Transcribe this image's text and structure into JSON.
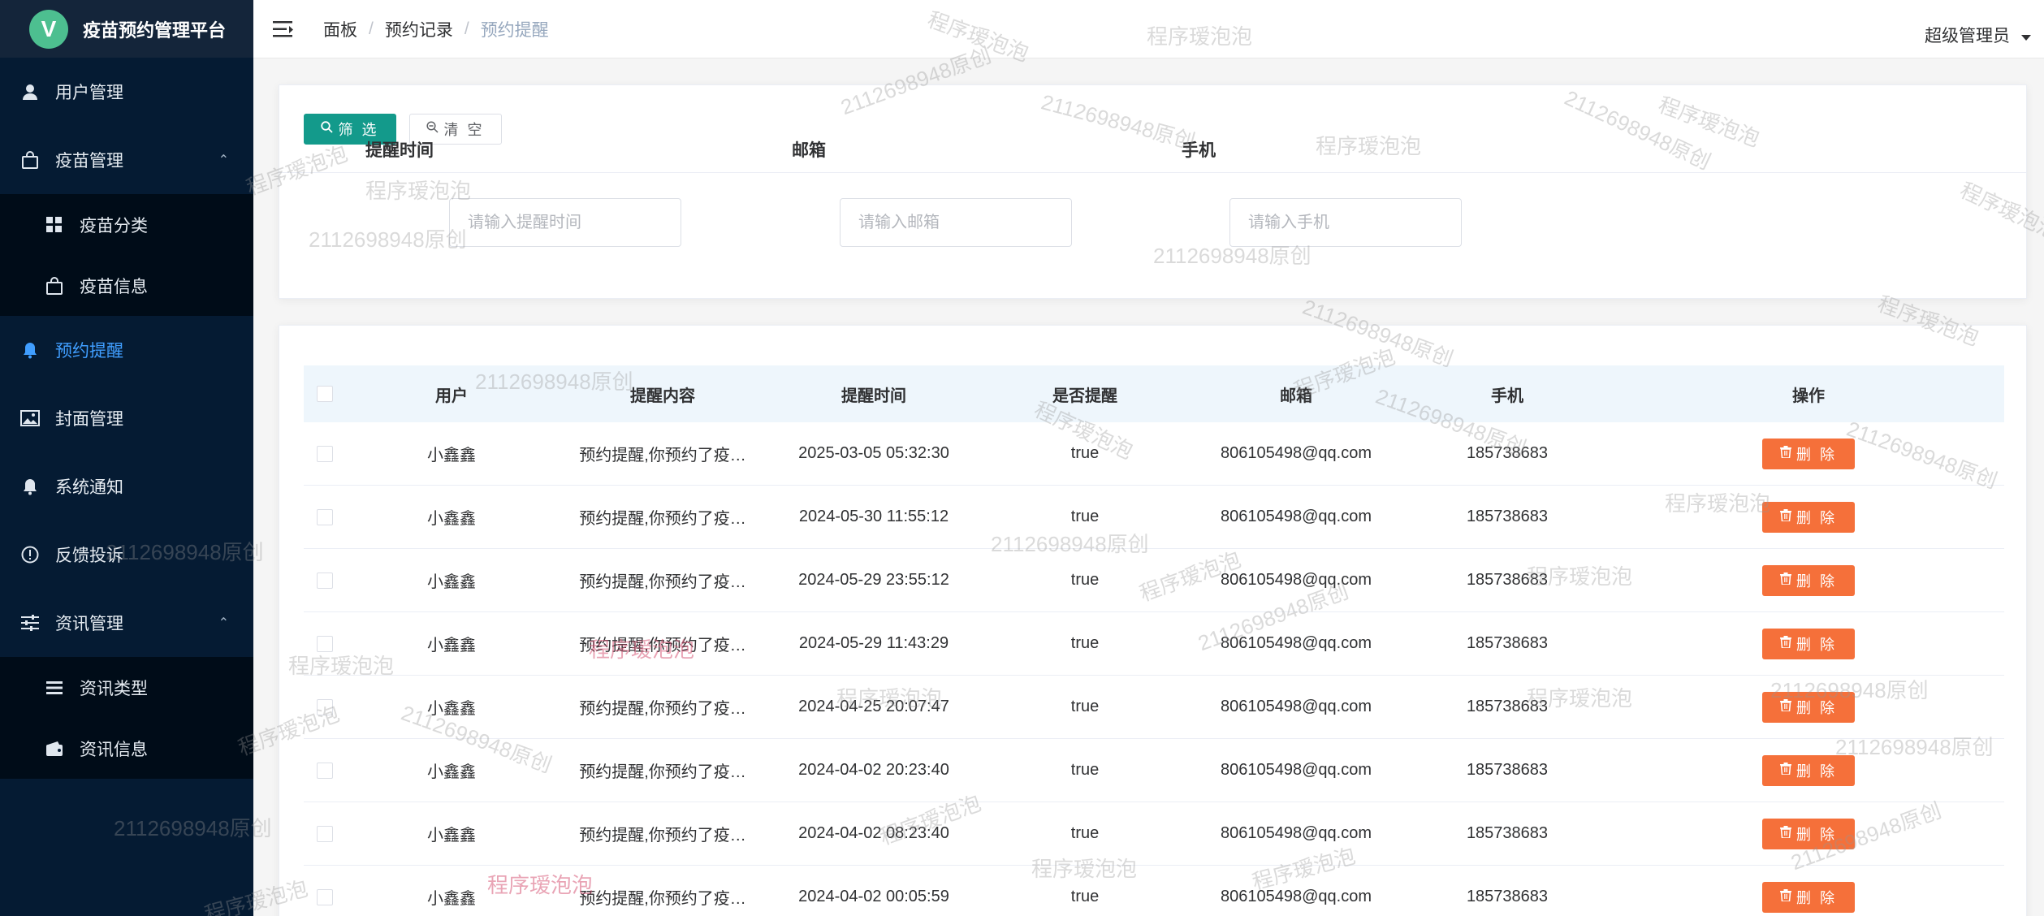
{
  "app": {
    "logo_letter": "V",
    "title": "疫苗预约管理平台"
  },
  "sidebar": {
    "items": [
      {
        "label": "用户管理",
        "icon": "user-icon",
        "caret": ""
      },
      {
        "label": "疫苗管理",
        "icon": "bag-icon",
        "caret": "⌃"
      },
      {
        "label": "疫苗分类",
        "icon": "grid-icon",
        "sub": true
      },
      {
        "label": "疫苗信息",
        "icon": "bag-icon",
        "sub": true
      },
      {
        "label": "预约提醒",
        "icon": "bell-icon",
        "active": true
      },
      {
        "label": "封面管理",
        "icon": "picture-icon"
      },
      {
        "label": "系统通知",
        "icon": "bell-icon"
      },
      {
        "label": "反馈投诉",
        "icon": "warning-icon"
      },
      {
        "label": "资讯管理",
        "icon": "sliders-icon",
        "caret": "⌃"
      },
      {
        "label": "资讯类型",
        "icon": "list-icon",
        "sub": true
      },
      {
        "label": "资讯信息",
        "icon": "wallet-icon",
        "sub": true
      }
    ]
  },
  "header": {
    "breadcrumb": [
      "面板",
      "预约记录",
      "预约提醒"
    ],
    "breadcrumb_sep": "/",
    "user": "超级管理员"
  },
  "filter": {
    "btn_filter": "筛 选",
    "btn_clear": "清 空",
    "fields": [
      {
        "label": "提醒时间",
        "placeholder": "请输入提醒时间"
      },
      {
        "label": "邮箱",
        "placeholder": "请输入邮箱"
      },
      {
        "label": "手机",
        "placeholder": "请输入手机"
      }
    ]
  },
  "table": {
    "headers": [
      "用户",
      "提醒内容",
      "提醒时间",
      "是否提醒",
      "邮箱",
      "手机",
      "操作"
    ],
    "delete_label": "删 除",
    "rows": [
      {
        "user": "小鑫鑫",
        "content": "预约提醒,你预约了疫…",
        "time": "2025-03-05 05:32:30",
        "flag": "true",
        "email": "806105498@qq.com",
        "phone": "185738683"
      },
      {
        "user": "小鑫鑫",
        "content": "预约提醒,你预约了疫…",
        "time": "2024-05-30 11:55:12",
        "flag": "true",
        "email": "806105498@qq.com",
        "phone": "185738683"
      },
      {
        "user": "小鑫鑫",
        "content": "预约提醒,你预约了疫…",
        "time": "2024-05-29 23:55:12",
        "flag": "true",
        "email": "806105498@qq.com",
        "phone": "185738683"
      },
      {
        "user": "小鑫鑫",
        "content": "预约提醒,你预约了疫…",
        "time": "2024-05-29 11:43:29",
        "flag": "true",
        "email": "806105498@qq.com",
        "phone": "185738683"
      },
      {
        "user": "小鑫鑫",
        "content": "预约提醒,你预约了疫…",
        "time": "2024-04-25 20:07:47",
        "flag": "true",
        "email": "806105498@qq.com",
        "phone": "185738683"
      },
      {
        "user": "小鑫鑫",
        "content": "预约提醒,你预约了疫…",
        "time": "2024-04-02 20:23:40",
        "flag": "true",
        "email": "806105498@qq.com",
        "phone": "185738683"
      },
      {
        "user": "小鑫鑫",
        "content": "预约提醒,你预约了疫…",
        "time": "2024-04-02 08:23:40",
        "flag": "true",
        "email": "806105498@qq.com",
        "phone": "185738683"
      },
      {
        "user": "小鑫鑫",
        "content": "预约提醒,你预约了疫…",
        "time": "2024-04-02 00:05:59",
        "flag": "true",
        "email": "806105498@qq.com",
        "phone": "185738683"
      }
    ]
  },
  "watermark": {
    "text_a": "2112698948原创",
    "text_b": "程序瑷泡泡"
  },
  "colors": {
    "sidebar_bg": "#051b33",
    "accent_active": "#409eff",
    "filter_btn": "#139a8b",
    "delete_btn": "#f5703a",
    "table_header_bg": "#eef6fc"
  }
}
